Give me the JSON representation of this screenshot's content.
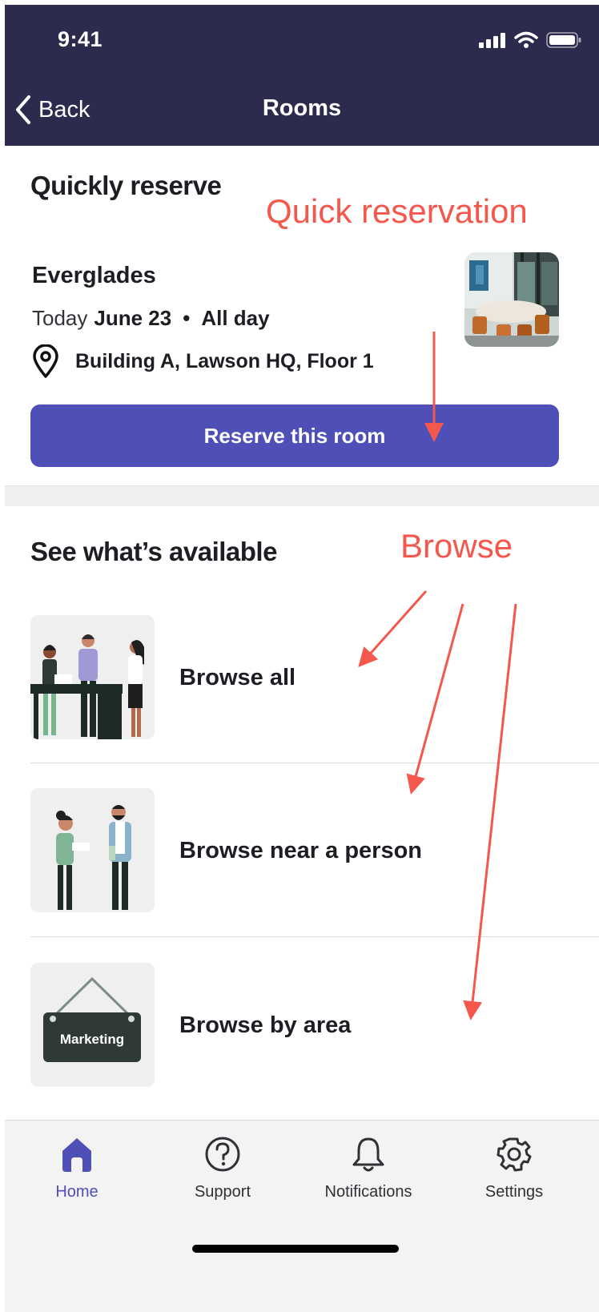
{
  "status_bar": {
    "time": "9:41"
  },
  "nav": {
    "back_label": "Back",
    "title": "Rooms"
  },
  "quick": {
    "title": "Quickly reserve",
    "annotation": "Quick reservation",
    "room_name": "Everglades",
    "day": "Today",
    "date": "June 23",
    "separator": "•",
    "duration": "All day",
    "location": "Building A, Lawson HQ, Floor 1",
    "button_label": "Reserve this room"
  },
  "browse": {
    "title": "See what’s available",
    "annotation": "Browse",
    "items": [
      {
        "label": "Browse all",
        "icon": "people-at-table-illustration"
      },
      {
        "label": "Browse near a person",
        "icon": "two-people-talking-illustration"
      },
      {
        "label": "Browse by area",
        "icon": "hanging-sign-illustration",
        "sign_text": "Marketing"
      }
    ]
  },
  "tabs": [
    {
      "label": "Home",
      "icon": "home-icon",
      "active": true
    },
    {
      "label": "Support",
      "icon": "question-circle-icon",
      "active": false
    },
    {
      "label": "Notifications",
      "icon": "bell-icon",
      "active": false
    },
    {
      "label": "Settings",
      "icon": "gear-icon",
      "active": false
    }
  ],
  "colors": {
    "header_bg": "#2d2b4d",
    "accent": "#4f4fb8",
    "annotation": "#f4574b",
    "tabbar_bg": "#f3f3f3"
  }
}
